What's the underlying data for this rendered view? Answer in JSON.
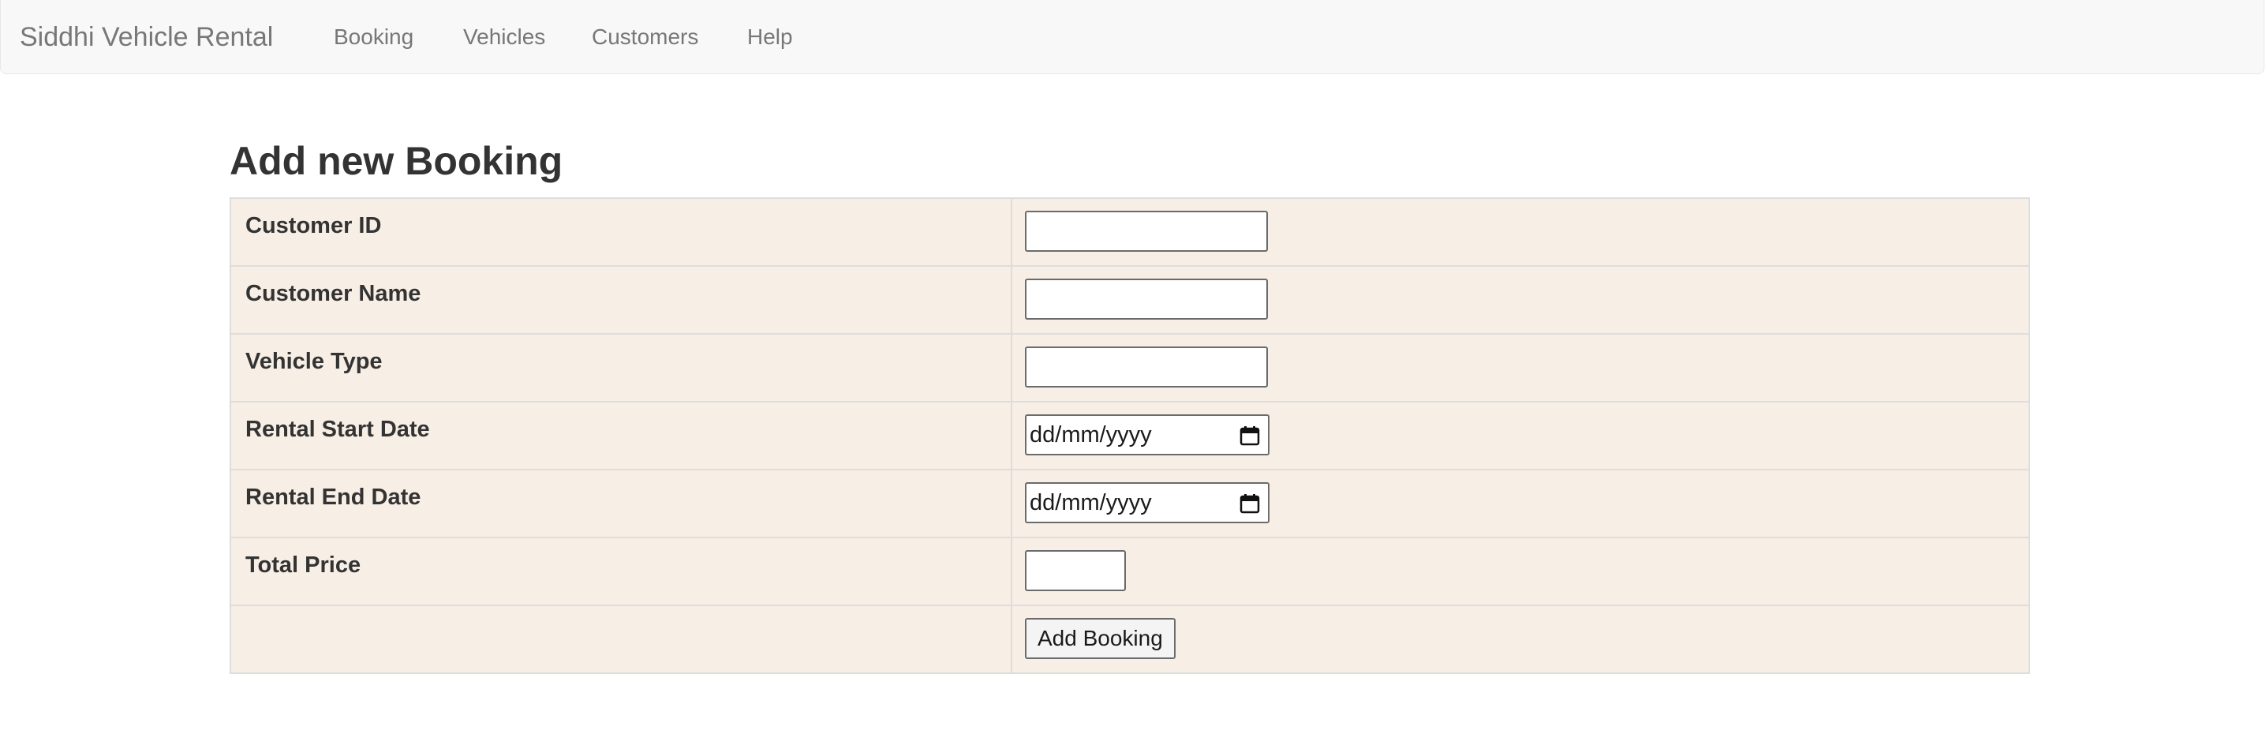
{
  "navbar": {
    "brand": "Siddhi Vehicle Rental",
    "links": [
      {
        "label": "Booking"
      },
      {
        "label": "Vehicles"
      },
      {
        "label": "Customers"
      },
      {
        "label": "Help"
      }
    ]
  },
  "page": {
    "title": "Add new Booking"
  },
  "form": {
    "fields": [
      {
        "label": "Customer ID",
        "value": "",
        "type": "text"
      },
      {
        "label": "Customer Name",
        "value": "",
        "type": "text"
      },
      {
        "label": "Vehicle Type",
        "value": "",
        "type": "text"
      },
      {
        "label": "Rental Start Date",
        "value": "",
        "type": "date",
        "placeholder": "dd/mm/yyyy"
      },
      {
        "label": "Rental End Date",
        "value": "",
        "type": "date",
        "placeholder": "dd/mm/yyyy"
      },
      {
        "label": "Total Price",
        "value": "",
        "type": "number"
      }
    ],
    "submit_label": "Add Booking"
  },
  "icons": {
    "date_picker": "calendar-icon"
  },
  "colors": {
    "navbar_bg": "#f8f8f8",
    "row_bg": "#f7eee5",
    "border": "#dddddd",
    "nav_text": "#777777",
    "heading_text": "#333333"
  }
}
